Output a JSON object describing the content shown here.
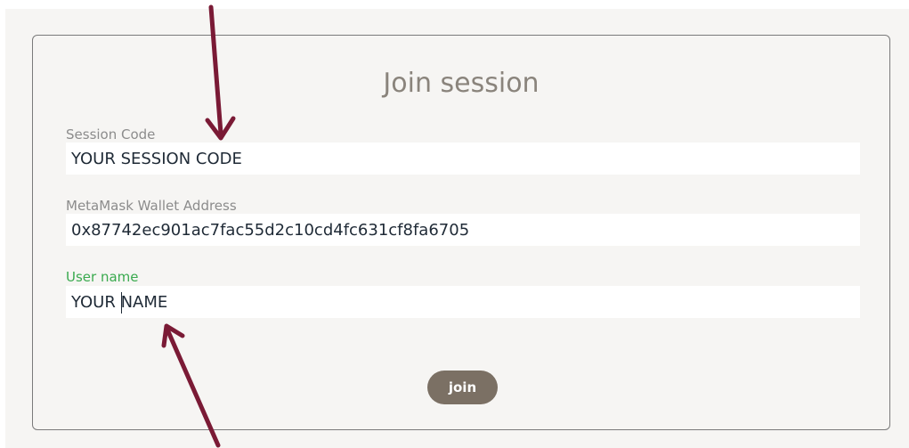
{
  "form": {
    "title": "Join session",
    "session_code": {
      "label": "Session Code",
      "value": "YOUR SESSION CODE"
    },
    "wallet": {
      "label": "MetaMask Wallet Address",
      "value": "0x87742ec901ac7fac55d2c10cd4fc631cf8fa6705"
    },
    "user_name": {
      "label": "User name",
      "value": "YOUR NAME"
    },
    "join_label": "join"
  },
  "colors": {
    "arrow": "#7a1a35",
    "button": "#7b7064",
    "active_label": "#3aaa4f",
    "title": "#8a847c"
  }
}
